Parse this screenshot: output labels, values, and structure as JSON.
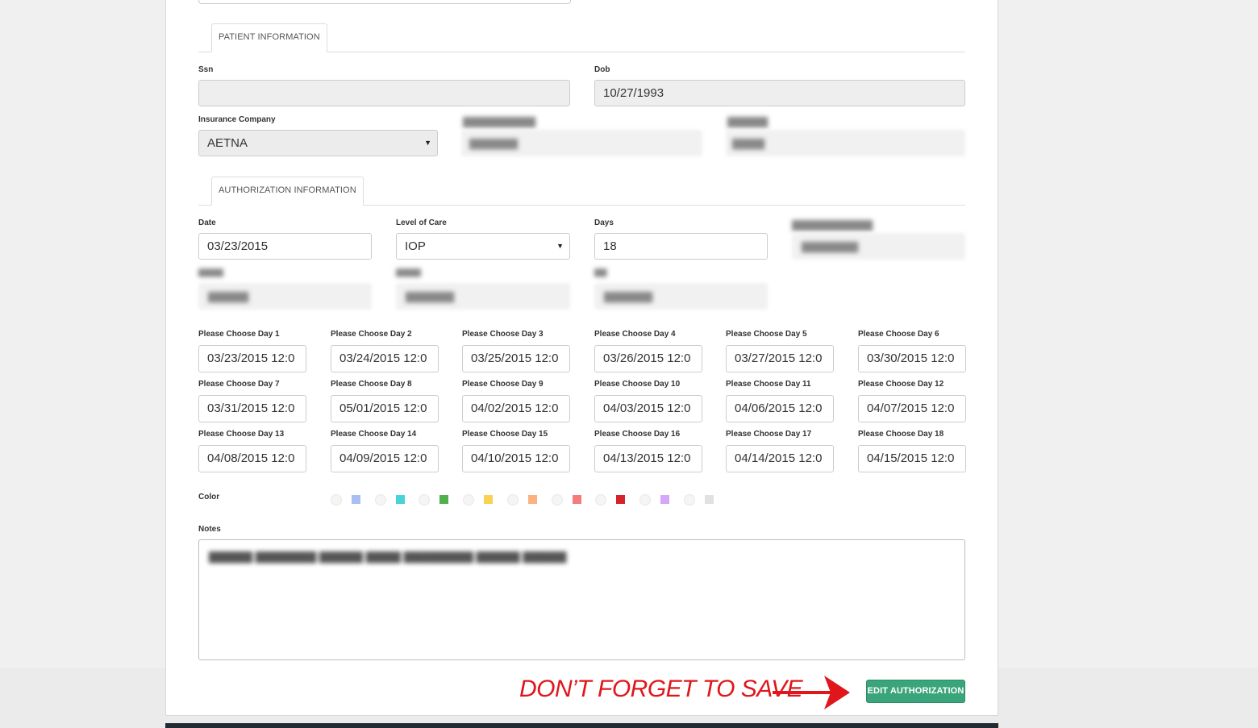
{
  "patient_tab": {
    "label": "PATIENT INFORMATION"
  },
  "patient": {
    "ssn_label": "Ssn",
    "ssn_value": "",
    "dob_label": "Dob",
    "dob_value": "10/27/1993",
    "insurance_label": "Insurance Company",
    "insurance_value": "AETNA"
  },
  "auth_tab": {
    "label": "AUTHORIZATION INFORMATION"
  },
  "auth": {
    "date_label": "Date",
    "date_value": "03/23/2015",
    "level_label": "Level of Care",
    "level_value": "IOP",
    "days_label": "Days",
    "days_value": "18"
  },
  "days": [
    {
      "label": "Please Choose Day 1",
      "value": "03/23/2015 12:0"
    },
    {
      "label": "Please Choose Day 2",
      "value": "03/24/2015 12:0"
    },
    {
      "label": "Please Choose Day 3",
      "value": "03/25/2015 12:0"
    },
    {
      "label": "Please Choose Day 4",
      "value": "03/26/2015 12:0"
    },
    {
      "label": "Please Choose Day 5",
      "value": "03/27/2015 12:0"
    },
    {
      "label": "Please Choose Day 6",
      "value": "03/30/2015 12:0"
    },
    {
      "label": "Please Choose Day 7",
      "value": "03/31/2015 12:0"
    },
    {
      "label": "Please Choose Day 8",
      "value": "05/01/2015 12:0"
    },
    {
      "label": "Please Choose Day 9",
      "value": "04/02/2015 12:0"
    },
    {
      "label": "Please Choose Day 10",
      "value": "04/03/2015 12:0"
    },
    {
      "label": "Please Choose Day 11",
      "value": "04/06/2015 12:0"
    },
    {
      "label": "Please Choose Day 12",
      "value": "04/07/2015 12:0"
    },
    {
      "label": "Please Choose Day 13",
      "value": "04/08/2015 12:0"
    },
    {
      "label": "Please Choose Day 14",
      "value": "04/09/2015 12:0"
    },
    {
      "label": "Please Choose Day 15",
      "value": "04/10/2015 12:0"
    },
    {
      "label": "Please Choose Day 16",
      "value": "04/13/2015 12:0"
    },
    {
      "label": "Please Choose Day 17",
      "value": "04/14/2015 12:0"
    },
    {
      "label": "Please Choose Day 18",
      "value": "04/15/2015 12:0"
    }
  ],
  "color": {
    "label": "Color",
    "swatches": [
      "#a9bff2",
      "#47d3d8",
      "#52b04c",
      "#f9d155",
      "#fbb27f",
      "#f47c7c",
      "#d6222b",
      "#d6a6fb",
      "#e1e1e1"
    ]
  },
  "notes": {
    "label": "Notes"
  },
  "save_reminder": "DON’T FORGET TO SAVE",
  "edit_button": "EDIT AUTHORIZATION"
}
